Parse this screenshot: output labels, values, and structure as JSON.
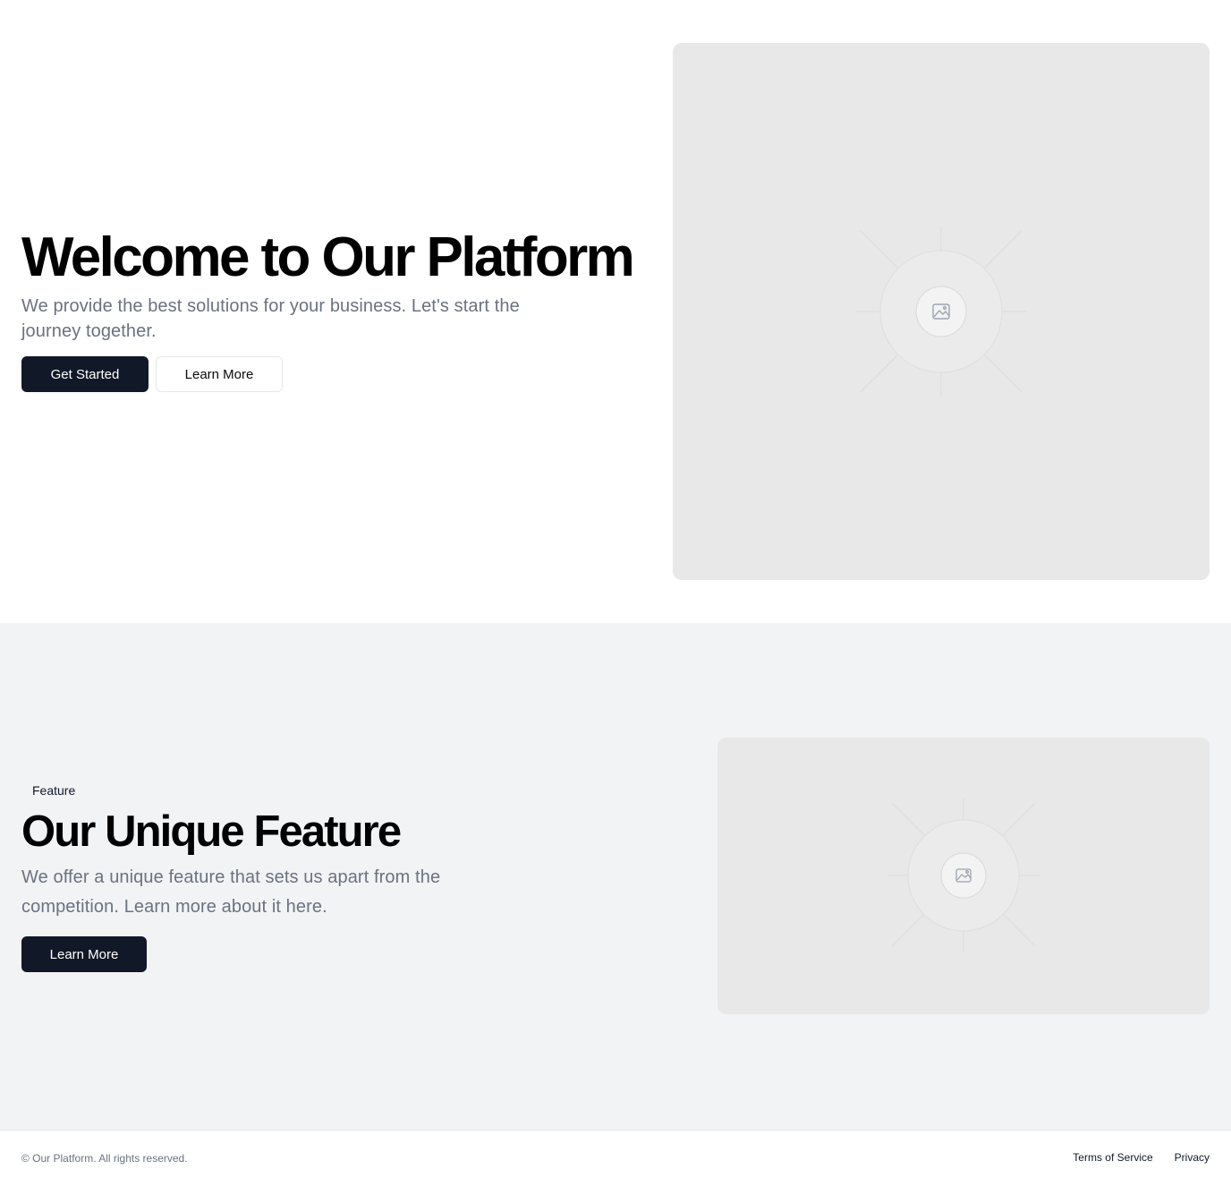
{
  "hero": {
    "title": "Welcome to Our Platform",
    "subtitle": "We provide the best solutions for your business. Let's start the journey together.",
    "primary_button": "Get Started",
    "secondary_button": "Learn More",
    "image_icon": "image-placeholder-icon"
  },
  "feature": {
    "badge": "Feature",
    "title": "Our Unique Feature",
    "description": "We offer a unique feature that sets us apart from the competition. Learn more about it here.",
    "button": "Learn More",
    "image_icon": "image-placeholder-icon"
  },
  "footer": {
    "copyright": "© Our Platform. All rights reserved.",
    "links": [
      "Terms of Service",
      "Privacy"
    ]
  },
  "colors": {
    "primary": "#111827",
    "muted_text": "#6b7280",
    "section_bg": "#f2f3f5",
    "placeholder_bg": "#e8e8e8"
  }
}
